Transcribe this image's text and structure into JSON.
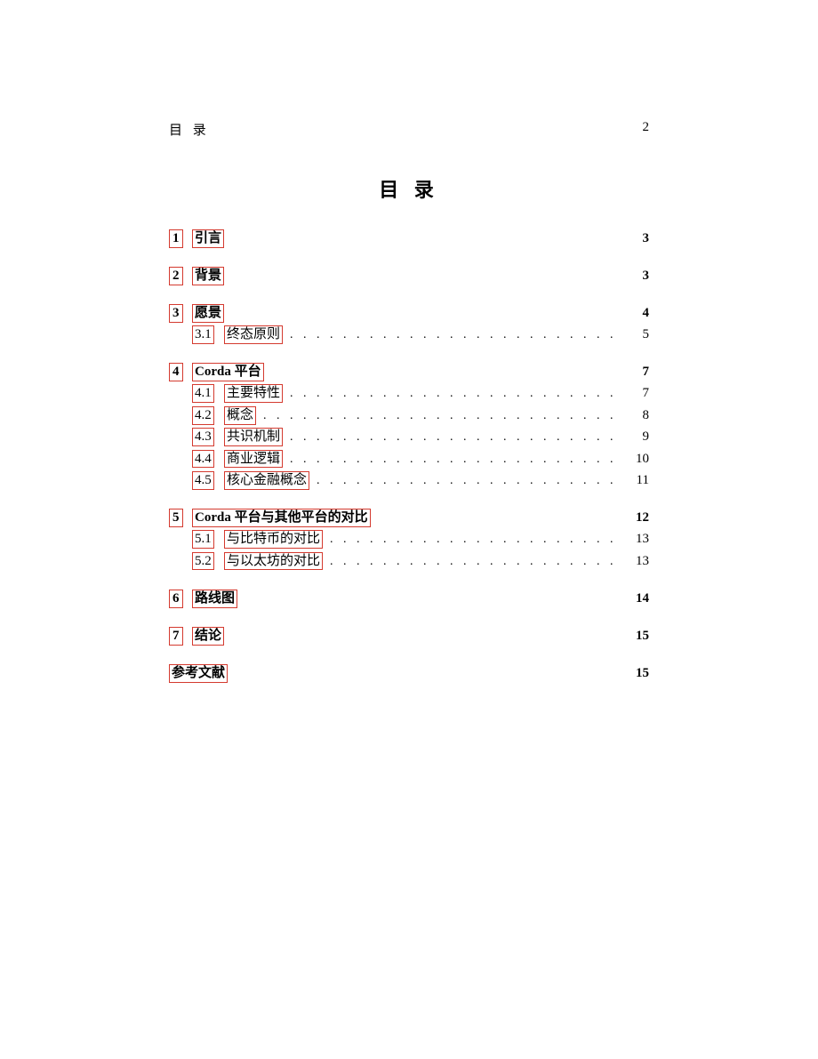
{
  "header": {
    "label": "目 录",
    "page_number": "2"
  },
  "toc_title": "目 录",
  "dot_leader": ". . . . . . . . . . . . . . . . . . . . . . . . . . . . . . . . . . . . . . . . . . . . . . . . . . . . . .",
  "sections": [
    {
      "num": "1",
      "label": "引言",
      "page": "3",
      "subs": []
    },
    {
      "num": "2",
      "label": "背景",
      "page": "3",
      "subs": []
    },
    {
      "num": "3",
      "label": "愿景",
      "page": "4",
      "subs": [
        {
          "num": "3.1",
          "label": "终态原则",
          "page": "5"
        }
      ]
    },
    {
      "num": "4",
      "label": "Corda 平台",
      "page": "7",
      "subs": [
        {
          "num": "4.1",
          "label": "主要特性",
          "page": "7"
        },
        {
          "num": "4.2",
          "label": "概念",
          "page": "8"
        },
        {
          "num": "4.3",
          "label": "共识机制",
          "page": "9"
        },
        {
          "num": "4.4",
          "label": "商业逻辑",
          "page": "10"
        },
        {
          "num": "4.5",
          "label": "核心金融概念",
          "page": "11"
        }
      ]
    },
    {
      "num": "5",
      "label": "Corda 平台与其他平台的对比",
      "page": "12",
      "subs": [
        {
          "num": "5.1",
          "label": "与比特币的对比",
          "page": "13"
        },
        {
          "num": "5.2",
          "label": "与以太坊的对比",
          "page": "13"
        }
      ]
    },
    {
      "num": "6",
      "label": "路线图",
      "page": "14",
      "subs": []
    },
    {
      "num": "7",
      "label": "结论",
      "page": "15",
      "subs": []
    }
  ],
  "references": {
    "label": "参考文献",
    "page": "15"
  }
}
